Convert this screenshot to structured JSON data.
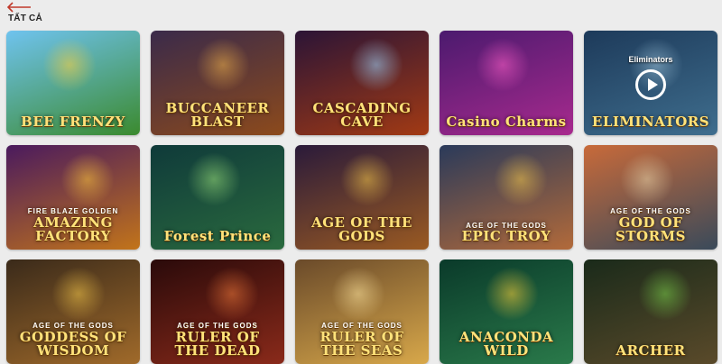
{
  "header": {
    "title": "TẤT CẢ"
  },
  "games": [
    {
      "name": "BEE FRENZY",
      "sub": "",
      "colors": [
        "#6fc3ef",
        "#3b8a2e"
      ],
      "accent": "#ffd23a"
    },
    {
      "name": "BUCCANEER BLAST",
      "sub": "",
      "colors": [
        "#3a2a4a",
        "#8c4a1c"
      ],
      "accent": "#f0b24a"
    },
    {
      "name": "CASCADING CAVE",
      "sub": "",
      "colors": [
        "#2b1436",
        "#a23a14"
      ],
      "accent": "#9fd8ff"
    },
    {
      "name": "Casino Charms",
      "sub": "",
      "colors": [
        "#4b1a6e",
        "#a82a8e"
      ],
      "accent": "#ff5fc8"
    },
    {
      "name": "ELIMINATORS",
      "sub": "",
      "colors": [
        "#1d3a5a",
        "#3f6e8e"
      ],
      "accent": "#9bc1d8",
      "overlay": "Eliminators"
    },
    {
      "name": "AMAZING FACTORY",
      "sub": "FIRE BLAZE GOLDEN",
      "colors": [
        "#4a1a5e",
        "#c2741a"
      ],
      "accent": "#ffc83a"
    },
    {
      "name": "Forest Prince",
      "sub": "",
      "colors": [
        "#0f3a3a",
        "#2a6a3e"
      ],
      "accent": "#9be07a"
    },
    {
      "name": "AGE OF THE GODS",
      "sub": "",
      "colors": [
        "#2a1a3a",
        "#9a5a22"
      ],
      "accent": "#f5c84a"
    },
    {
      "name": "EPIC TROY",
      "sub": "AGE OF THE GODS",
      "colors": [
        "#2a3a5a",
        "#b26a3a"
      ],
      "accent": "#f5c84a"
    },
    {
      "name": "GOD OF STORMS",
      "sub": "AGE OF THE GODS",
      "colors": [
        "#c86a3a",
        "#3a4a5a"
      ],
      "accent": "#e8d4a8"
    },
    {
      "name": "GODDESS OF WISDOM",
      "sub": "AGE OF THE GODS",
      "colors": [
        "#3a2a1a",
        "#a06a2a"
      ],
      "accent": "#f5c84a"
    },
    {
      "name": "RULER OF THE DEAD",
      "sub": "AGE OF THE GODS",
      "colors": [
        "#2a0a0a",
        "#8a2a1a"
      ],
      "accent": "#f07a3a"
    },
    {
      "name": "RULER OF THE SEAS",
      "sub": "AGE OF THE GODS",
      "colors": [
        "#6a4a2a",
        "#d8a84a"
      ],
      "accent": "#ffe6a0"
    },
    {
      "name": "ANACONDA WILD",
      "sub": "",
      "colors": [
        "#0a3a2a",
        "#2a7a4a"
      ],
      "accent": "#ffd23a"
    },
    {
      "name": "ARCHER",
      "sub": "",
      "colors": [
        "#1a2a1a",
        "#5a4a2a"
      ],
      "accent": "#7ad04a"
    }
  ]
}
